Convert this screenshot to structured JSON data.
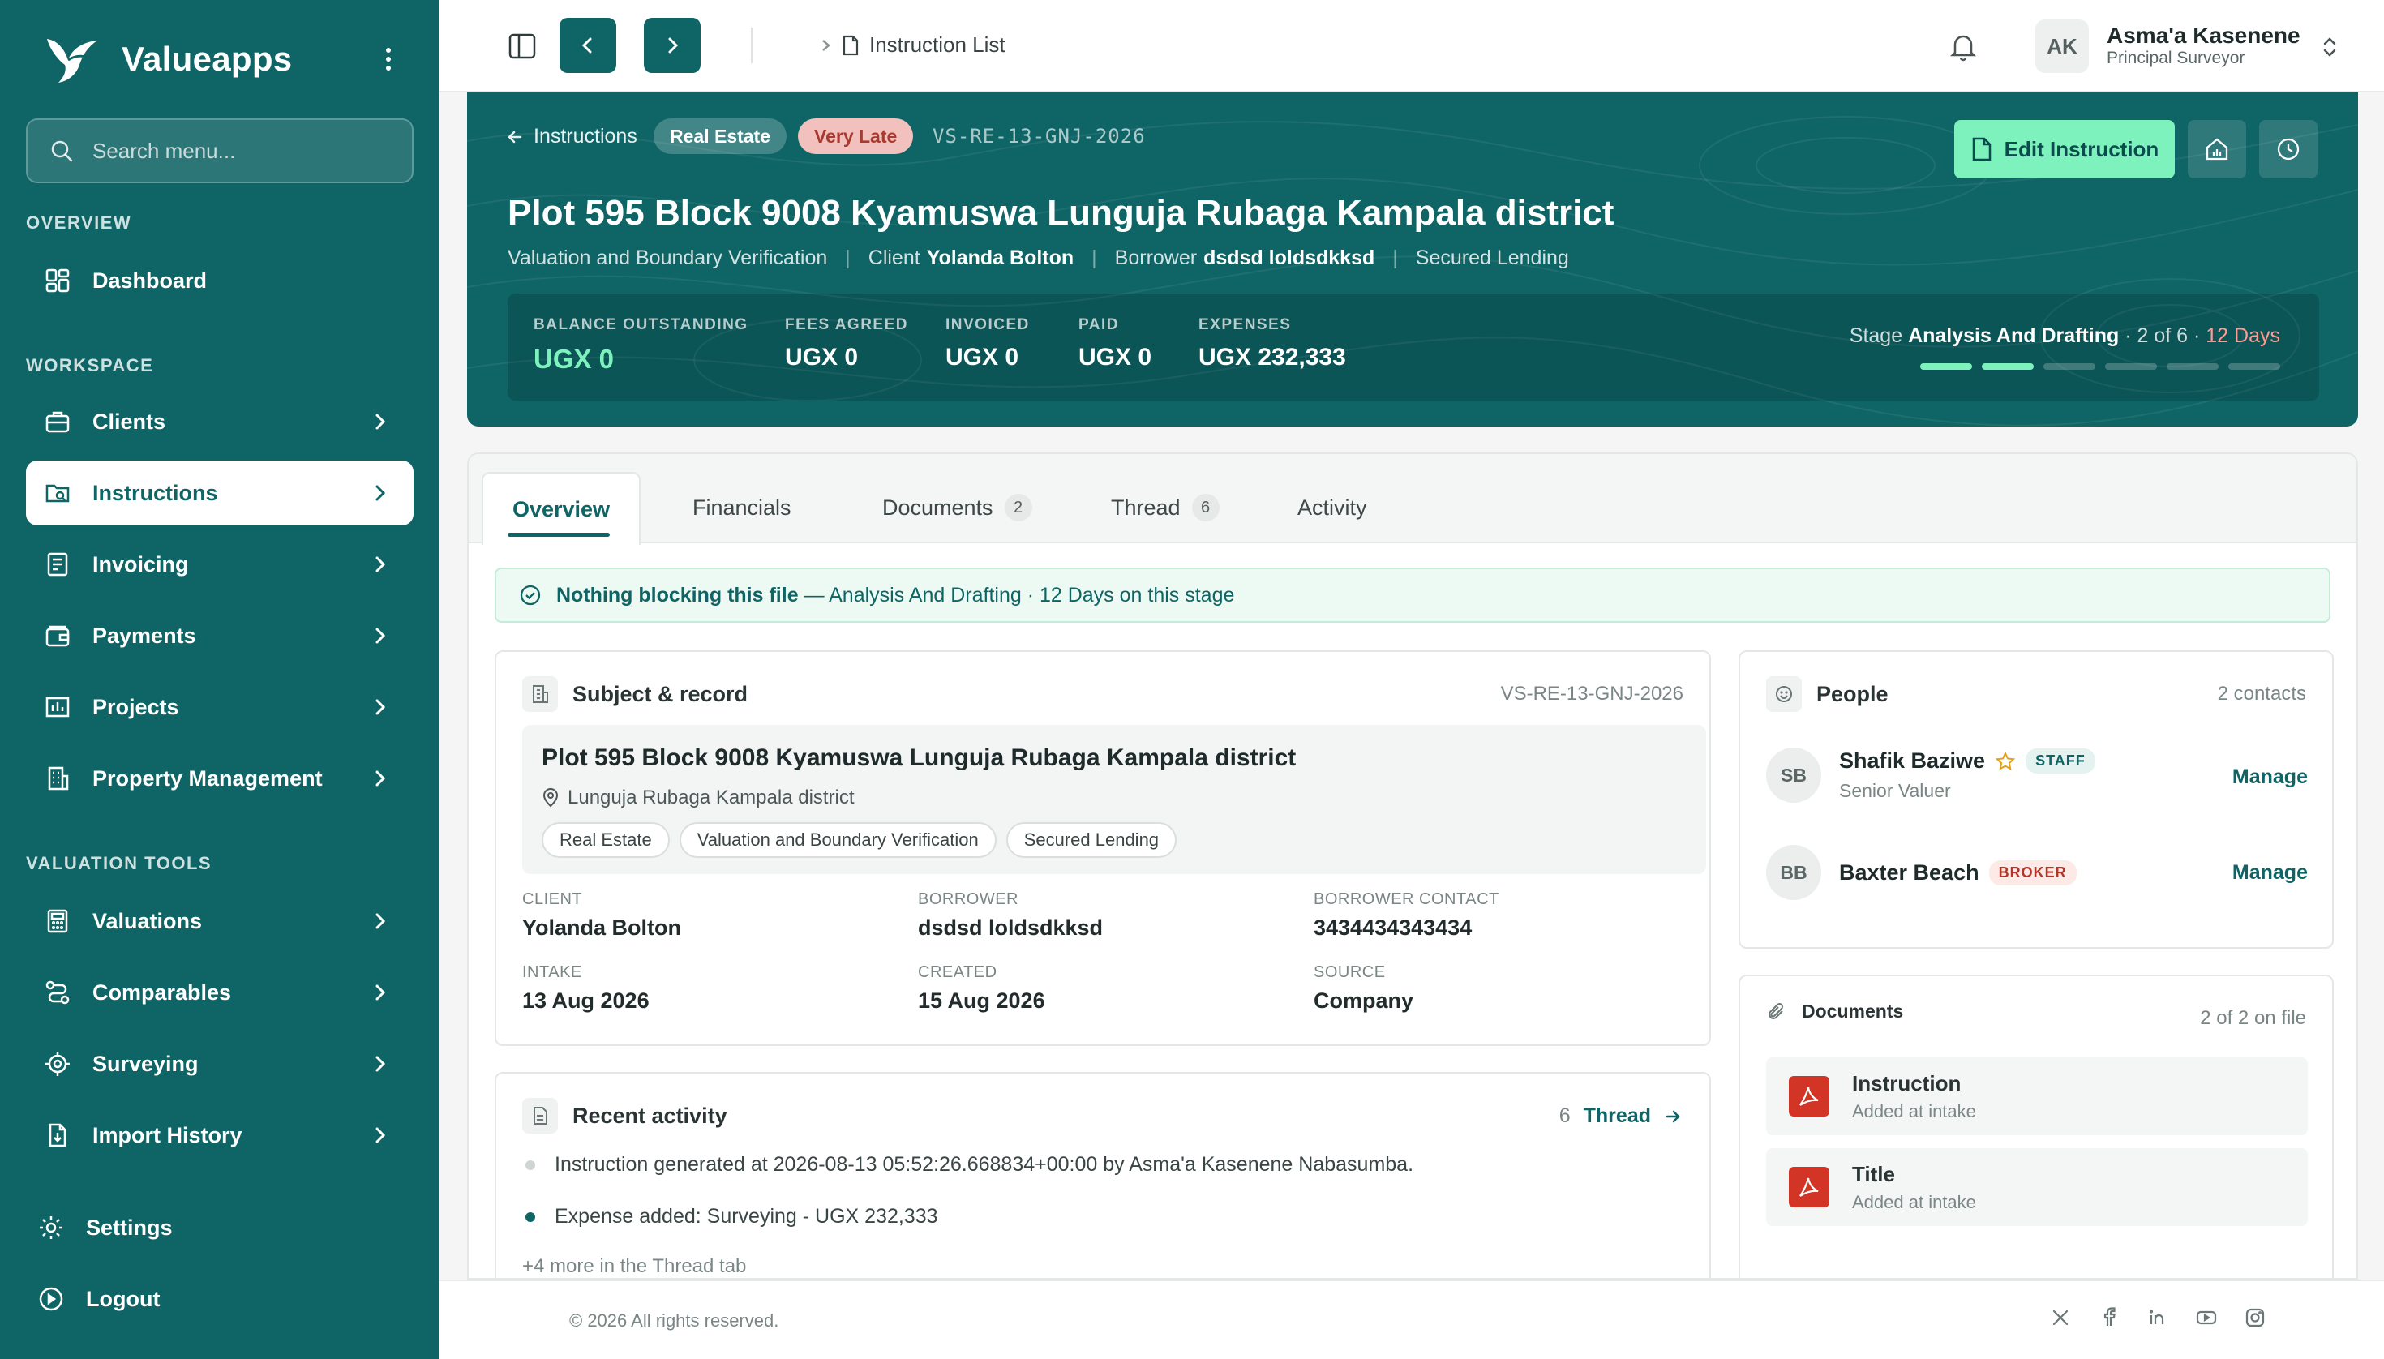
{
  "app": {
    "name": "Valueapps"
  },
  "sidebar": {
    "search_placeholder": "Search menu...",
    "sections": {
      "overview": "OVERVIEW",
      "workspace": "WORKSPACE",
      "valuation_tools": "VALUATION TOOLS"
    },
    "items": {
      "dashboard": "Dashboard",
      "clients": "Clients",
      "instructions": "Instructions",
      "invoicing": "Invoicing",
      "payments": "Payments",
      "projects": "Projects",
      "property_management": "Property Management",
      "valuations": "Valuations",
      "comparables": "Comparables",
      "surveying": "Surveying",
      "import_history": "Import History",
      "settings": "Settings",
      "logout": "Logout"
    },
    "active_item": "Instructions"
  },
  "topbar": {
    "breadcrumb": "Instruction List",
    "user": {
      "initials": "AK",
      "name": "Asma'a Kasenene",
      "role": "Principal Surveyor"
    }
  },
  "hero": {
    "back_label": "Instructions",
    "category_pill": "Real Estate",
    "status_pill": "Very Late",
    "reference": "VS-RE-13-GNJ-2026",
    "edit_label": "Edit Instruction",
    "title": "Plot 595 Block 9008 Kyamuswa Lunguja Rubaga Kampala district",
    "meta": {
      "service": "Valuation and Boundary Verification",
      "client_label": "Client",
      "client": "Yolanda Bolton",
      "borrower_label": "Borrower",
      "borrower": "dsdsd loldsdkksd",
      "purpose": "Secured Lending"
    },
    "financials": {
      "balance_label": "BALANCE OUTSTANDING",
      "balance": "UGX 0",
      "fees_label": "FEES AGREED",
      "fees": "UGX 0",
      "invoiced_label": "INVOICED",
      "invoiced": "UGX 0",
      "paid_label": "PAID",
      "paid": "UGX 0",
      "expenses_label": "EXPENSES",
      "expenses": "UGX 232,333"
    },
    "stage": {
      "label": "Stage",
      "name": "Analysis And Drafting",
      "progress": "· 2 of 6 ·",
      "days": "12 Days",
      "current": 2,
      "total": 6
    }
  },
  "tabs": {
    "overview": "Overview",
    "financials": "Financials",
    "documents": "Documents",
    "documents_count": "2",
    "thread": "Thread",
    "thread_count": "6",
    "activity": "Activity"
  },
  "alert": {
    "title": "Nothing blocking this file",
    "detail": "— Analysis And Drafting · 12 Days on this stage"
  },
  "subject": {
    "heading": "Subject & record",
    "reference": "VS-RE-13-GNJ-2026",
    "title": "Plot 595 Block 9008 Kyamuswa Lunguja Rubaga Kampala district",
    "location": "Lunguja Rubaga Kampala district",
    "tags": [
      "Real Estate",
      "Valuation and Boundary Verification",
      "Secured Lending"
    ],
    "fields": {
      "client_label": "CLIENT",
      "client": "Yolanda Bolton",
      "borrower_label": "BORROWER",
      "borrower": "dsdsd loldsdkksd",
      "contact_label": "BORROWER CONTACT",
      "contact": "3434434343434",
      "intake_label": "INTAKE",
      "intake": "13 Aug 2026",
      "created_label": "CREATED",
      "created": "15 Aug 2026",
      "source_label": "SOURCE",
      "source": "Company"
    }
  },
  "people": {
    "heading": "People",
    "count": "2 contacts",
    "list": [
      {
        "initials": "SB",
        "name": "Shafik Baziwe",
        "badge": "STAFF",
        "role": "Senior Valuer",
        "action": "Manage"
      },
      {
        "initials": "BB",
        "name": "Baxter Beach",
        "badge": "BROKER",
        "action": "Manage"
      }
    ]
  },
  "documents": {
    "heading": "Documents",
    "count": "2 of 2 on file",
    "list": [
      {
        "name": "Instruction",
        "sub": "Added at intake"
      },
      {
        "name": "Title",
        "sub": "Added at intake"
      }
    ]
  },
  "activity": {
    "heading": "Recent activity",
    "count": "6",
    "link": "Thread",
    "items": [
      "Instruction generated at 2026-08-13 05:52:26.668834+00:00 by Asma'a Kasenene Nabasumba.",
      "Expense added: Surveying - UGX 232,333"
    ],
    "more": "+4 more in the Thread tab"
  },
  "footer": {
    "copyright": "© 2026 All rights reserved."
  },
  "colors": {
    "brand": "#0f6466",
    "accent": "#7ef2bd",
    "late": "#a83a32"
  }
}
